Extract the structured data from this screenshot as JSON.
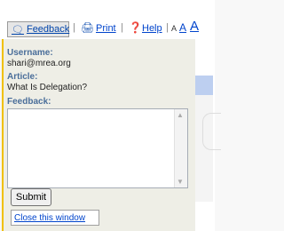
{
  "toolbar": {
    "feedback_label": "Feedback",
    "print_label": "Print",
    "help_label": "Help",
    "separator": "|",
    "font_size_labels": [
      "A",
      "A",
      "A"
    ]
  },
  "panel": {
    "username_label": "Username:",
    "username_value": "shari@mrea.org",
    "article_label": "Article:",
    "article_value": "What Is Delegation?",
    "feedback_label": "Feedback:",
    "feedback_text": "",
    "submit_label": "Submit",
    "close_label": "Close this window"
  },
  "colors": {
    "frame_border": "#f0c000",
    "label_text": "#4a6e9a",
    "link": "#0044cc",
    "panel_bg": "#eeeee6"
  },
  "icons": {
    "feedback": "speech-bubble-icon",
    "print": "printer-icon",
    "help": "help-icon"
  }
}
